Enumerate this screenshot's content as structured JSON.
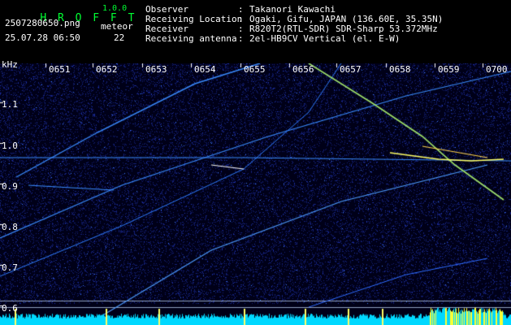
{
  "app": {
    "title": "H R O F F T",
    "version": "1.0.0"
  },
  "file": {
    "name": "2507280650.png",
    "datetime": "25.07.28 06:50"
  },
  "meteor": {
    "label": "meteor",
    "count": "22"
  },
  "info": [
    {
      "key": "Observer",
      "sep": ":",
      "value": "Takanori Kawachi"
    },
    {
      "key": "Receiving Location",
      "sep": ":",
      "value": "Ogaki, Gifu, JAPAN (136.60E, 35.35N)"
    },
    {
      "key": "Receiver",
      "sep": ":",
      "value": "R820T2(RTL-SDR) SDR-Sharp 53.372MHz"
    },
    {
      "key": "Receiving antenna",
      "sep": ":",
      "value": "2el-HB9CV Vertical (el. E-W)"
    }
  ],
  "y_unit": "kHz",
  "time_ticks": [
    "0651",
    "0652",
    "0653",
    "0654",
    "0655",
    "0656",
    "0657",
    "0658",
    "0659",
    "0700"
  ],
  "freq_ticks": [
    "1.1",
    "1.0",
    "0.9",
    "0.8",
    "0.7",
    "0.6"
  ],
  "colors": {
    "background": "#000020",
    "trace": "#66ccff",
    "bright": "#ffff66",
    "noise": "#1a2a8a",
    "bottom": "#00d8ff"
  }
}
